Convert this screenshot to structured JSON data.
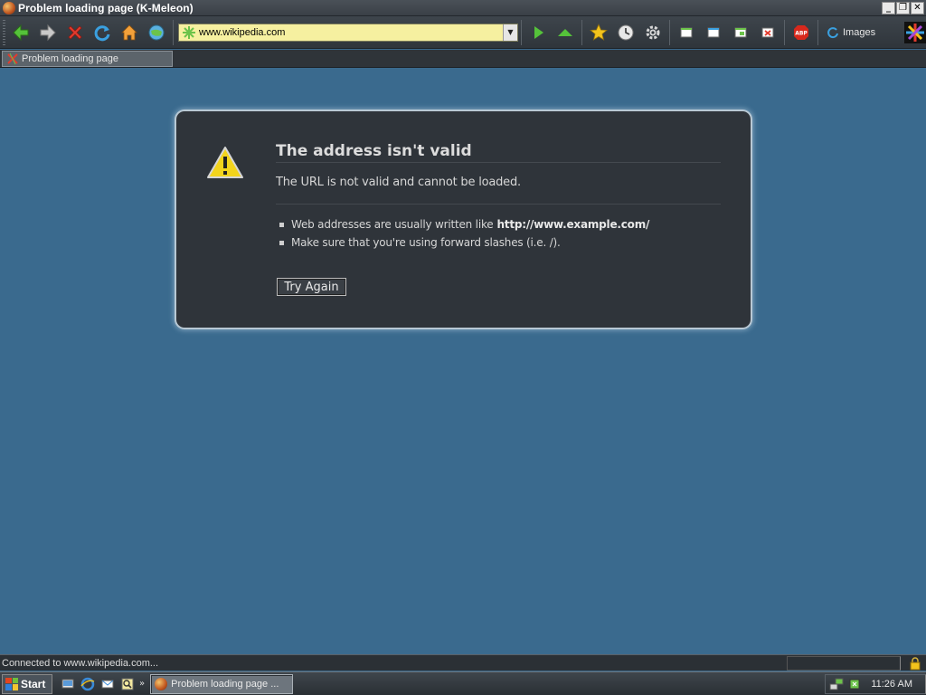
{
  "window": {
    "title": "Problem loading page (K-Meleon)",
    "controls": [
      "_",
      "❐",
      "✕"
    ]
  },
  "toolbar": {
    "url": "www.wikipedia.com",
    "images_label": "Images",
    "buttons": [
      "back-icon",
      "forward-icon",
      "stop-icon",
      "reload-icon",
      "home-icon",
      "globe-icon",
      "go-icon",
      "up-icon",
      "bookmarks-icon",
      "history-icon",
      "settings-icon",
      "window-icon-1",
      "window-icon-2",
      "window-icon-3",
      "close-tab-icon",
      "adblock-icon"
    ]
  },
  "tabs": [
    {
      "label": "Problem loading page"
    }
  ],
  "error": {
    "title": "The address isn't valid",
    "description": "The URL is not valid and cannot be loaded.",
    "tips": [
      {
        "text": "Web addresses are usually written like",
        "bold": "http://www.example.com/"
      },
      {
        "text": "Make sure that you're using forward slashes (i.e. /).",
        "bold": ""
      }
    ],
    "try_again": "Try Again"
  },
  "status": {
    "text": "Connected to www.wikipedia.com..."
  },
  "taskbar": {
    "start": "Start",
    "task": "Problem loading page ...",
    "more": "»",
    "clock": "11:26 AM"
  },
  "colors": {
    "page_bg": "#3a6a8e",
    "box_bg": "#2f343a",
    "url_bg": "#f6f0a0",
    "accent_green": "#5cc23a",
    "warn_yellow": "#f3d41c"
  }
}
